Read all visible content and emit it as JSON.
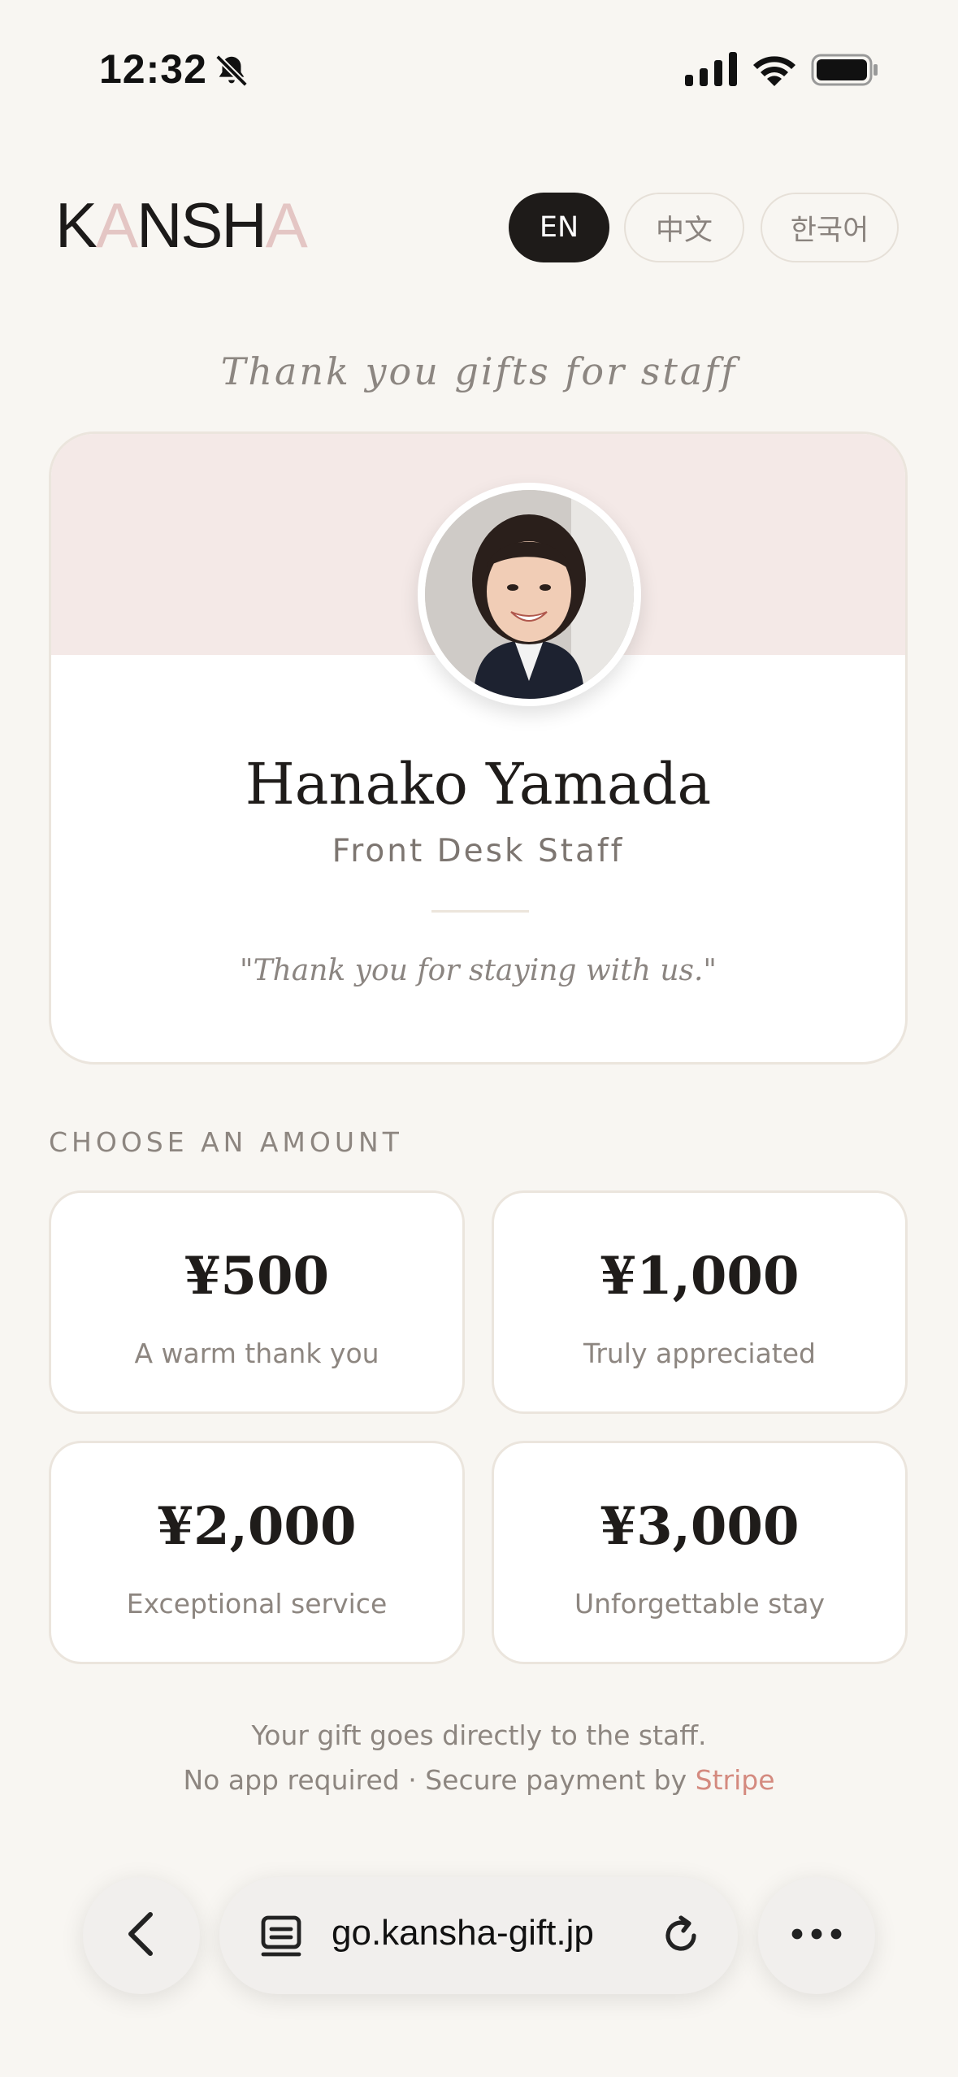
{
  "status_bar": {
    "time": "12:32"
  },
  "header": {
    "logo": {
      "part1": "K",
      "accent1": "A",
      "part2": "NSH",
      "accent2": "A"
    },
    "languages": [
      "EN",
      "中文",
      "한국어"
    ],
    "active_language": "EN"
  },
  "subtitle": "Thank you gifts for staff",
  "staff": {
    "name": "Hanako Yamada",
    "role": "Front Desk Staff",
    "quote": "\"Thank you for staying with us.\""
  },
  "amount_section": {
    "heading": "CHOOSE AN AMOUNT",
    "options": [
      {
        "value": "¥500",
        "label": "A warm thank you"
      },
      {
        "value": "¥1,000",
        "label": "Truly appreciated"
      },
      {
        "value": "¥2,000",
        "label": "Exceptional service"
      },
      {
        "value": "¥3,000",
        "label": "Unforgettable stay"
      }
    ]
  },
  "footer": {
    "line1": "Your gift goes directly to the staff.",
    "line2_prefix": "No app required · Secure payment by ",
    "line2_link": "Stripe"
  },
  "browser": {
    "url": "go.kansha-gift.jp"
  },
  "icons": [
    "bell-slash-icon",
    "signal-icon",
    "wifi-icon",
    "battery-icon",
    "back-arrow-icon",
    "tabs-icon",
    "reload-icon",
    "more-icon"
  ],
  "colors": {
    "accent": "#e4c6c4",
    "link": "#d48a7f",
    "background": "#f8f6f2",
    "band": "#f4e9e7"
  }
}
